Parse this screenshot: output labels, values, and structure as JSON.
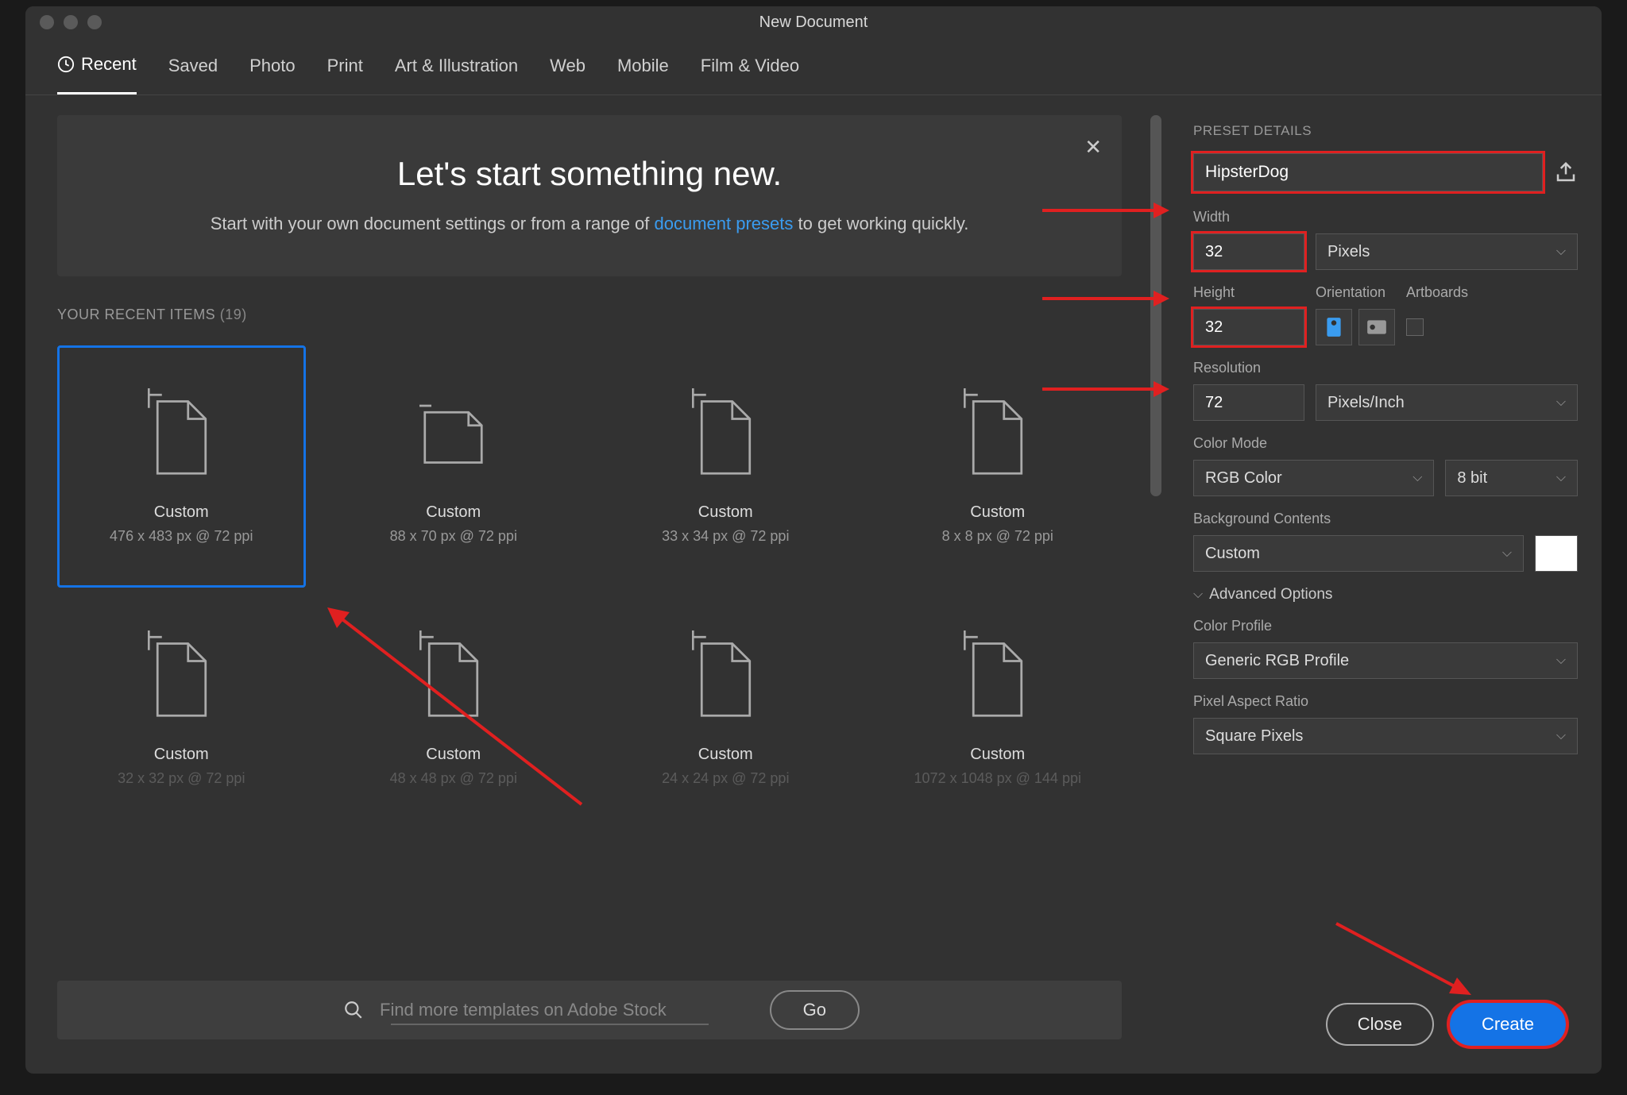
{
  "window": {
    "title": "New Document"
  },
  "tabs": [
    "Recent",
    "Saved",
    "Photo",
    "Print",
    "Art & Illustration",
    "Web",
    "Mobile",
    "Film & Video"
  ],
  "hero": {
    "title": "Let's start something new.",
    "text_before": "Start with your own document settings or from a range of ",
    "link": "document presets",
    "text_after": " to get working quickly."
  },
  "recent": {
    "label": "YOUR RECENT ITEMS",
    "count": "(19)",
    "items": [
      {
        "name": "Custom",
        "dims": "476 x 483 px @ 72 ppi"
      },
      {
        "name": "Custom",
        "dims": "88 x 70 px @ 72 ppi"
      },
      {
        "name": "Custom",
        "dims": "33 x 34 px @ 72 ppi"
      },
      {
        "name": "Custom",
        "dims": "8 x 8 px @ 72 ppi"
      },
      {
        "name": "Custom",
        "dims": "32 x 32 px @ 72 ppi"
      },
      {
        "name": "Custom",
        "dims": "48 x 48 px @ 72 ppi"
      },
      {
        "name": "Custom",
        "dims": "24 x 24 px @ 72 ppi"
      },
      {
        "name": "Custom",
        "dims": "1072 x 1048 px @ 144 ppi"
      }
    ]
  },
  "search": {
    "placeholder": "Find more templates on Adobe Stock",
    "go": "Go"
  },
  "details": {
    "header": "PRESET DETAILS",
    "name": "HipsterDog",
    "width_label": "Width",
    "width": "32",
    "units": "Pixels",
    "height_label": "Height",
    "height": "32",
    "orientation_label": "Orientation",
    "artboards_label": "Artboards",
    "resolution_label": "Resolution",
    "resolution": "72",
    "res_units": "Pixels/Inch",
    "color_mode_label": "Color Mode",
    "color_mode": "RGB Color",
    "bit_depth": "8 bit",
    "bg_label": "Background Contents",
    "bg": "Custom",
    "advanced": "Advanced Options",
    "profile_label": "Color Profile",
    "profile": "Generic RGB Profile",
    "par_label": "Pixel Aspect Ratio",
    "par": "Square Pixels"
  },
  "footer": {
    "close": "Close",
    "create": "Create"
  }
}
